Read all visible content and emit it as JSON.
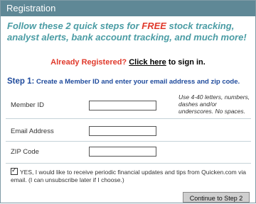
{
  "header": {
    "title": "Registration"
  },
  "intro": {
    "part1": "Follow these 2 quick steps for ",
    "free": "FREE",
    "part2": " stock tracking, analyst alerts, bank account tracking, and much more!"
  },
  "already_registered": {
    "question": "Already Registered?",
    "link_text": "Click here",
    "suffix": " to sign in."
  },
  "step1": {
    "lead": "Step 1:",
    "text": " Create a Member ID and enter your email address and zip code."
  },
  "form": {
    "member_id": {
      "label": "Member ID",
      "value": "",
      "hint": "Use 4-40 letters, numbers, dashes and/or underscores. No spaces."
    },
    "email": {
      "label": "Email Address",
      "value": ""
    },
    "zip": {
      "label": "ZIP Code",
      "value": ""
    }
  },
  "optin": {
    "checked": true,
    "text": "YES, I would like to receive periodic financial updates and tips from Quicken.com via email. (I can unsubscribe later if I choose.)"
  },
  "continue_button": {
    "label": "Continue to Step 2"
  }
}
